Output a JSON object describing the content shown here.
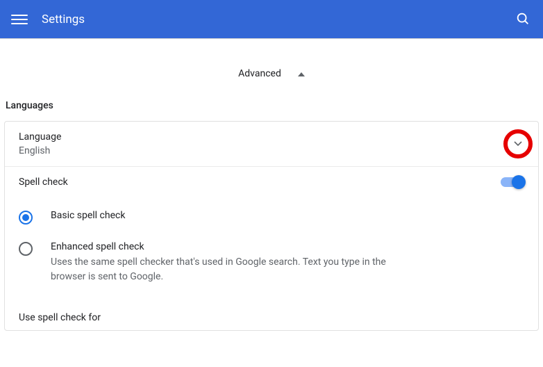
{
  "header": {
    "title": "Settings"
  },
  "advanced": {
    "label": "Advanced"
  },
  "languages": {
    "section_title": "Languages",
    "language_label": "Language",
    "language_value": "English",
    "spellcheck_label": "Spell check",
    "spellcheck_enabled": true,
    "options": [
      {
        "label": "Basic spell check",
        "description": "",
        "checked": true
      },
      {
        "label": "Enhanced spell check",
        "description": "Uses the same spell checker that's used in Google search. Text you type in the browser is sent to Google.",
        "checked": false
      }
    ],
    "use_for_label": "Use spell check for"
  }
}
